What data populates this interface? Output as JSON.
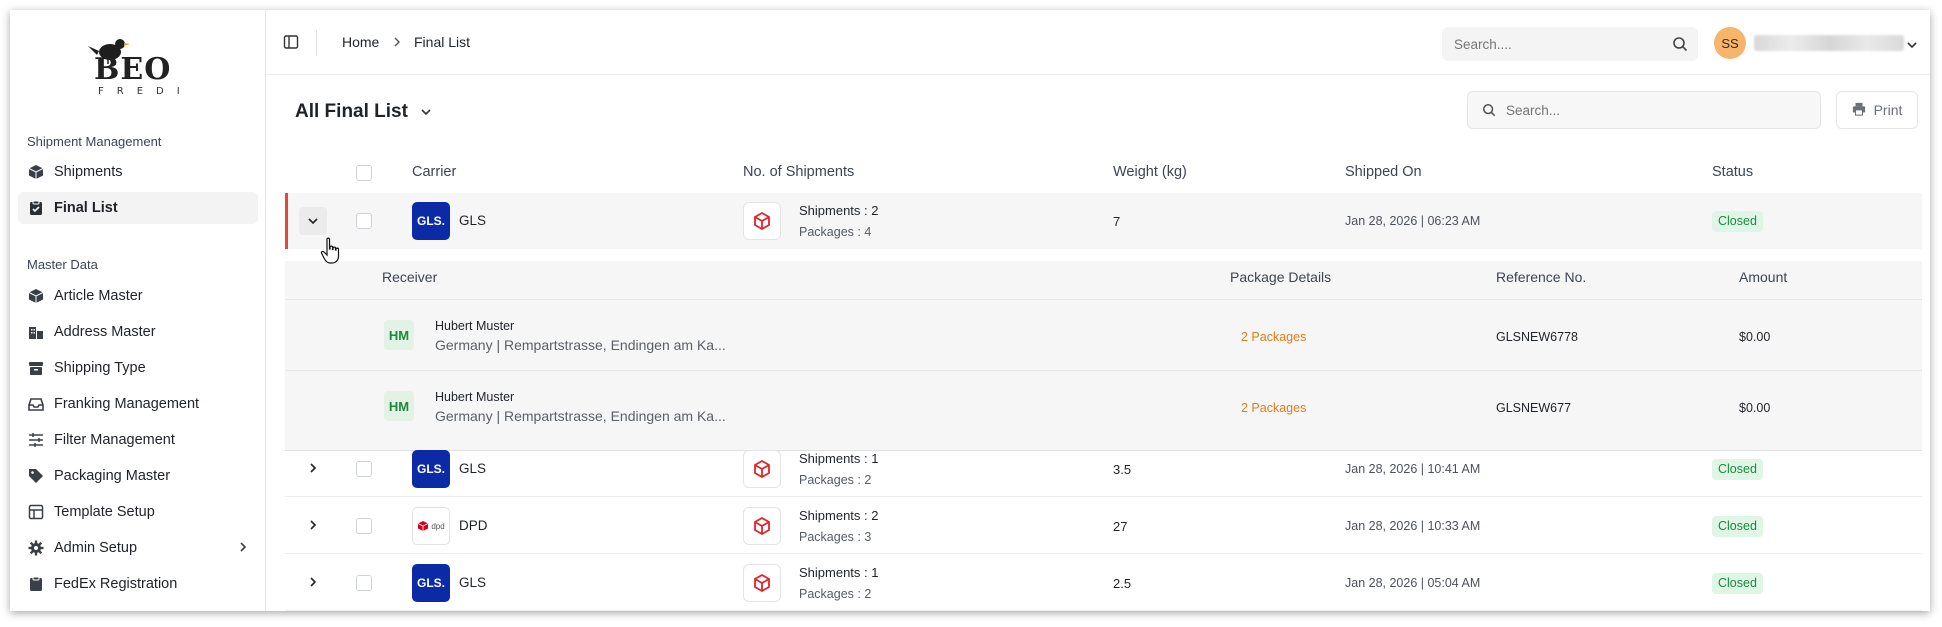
{
  "app": {
    "logo_text": "BEO",
    "logo_subtext": "FREDI"
  },
  "sidebar": {
    "sections": [
      {
        "title": "Shipment Management",
        "items": [
          {
            "label": "Shipments",
            "icon": "box-icon"
          },
          {
            "label": "Final List",
            "icon": "clipboard-check-icon",
            "active": true
          }
        ]
      },
      {
        "title": "Master Data",
        "items": [
          {
            "label": "Article Master",
            "icon": "box-icon"
          },
          {
            "label": "Address Master",
            "icon": "building-icon"
          },
          {
            "label": "Shipping Type",
            "icon": "archive-icon"
          },
          {
            "label": "Franking Management",
            "icon": "inbox-icon"
          },
          {
            "label": "Filter Management",
            "icon": "sliders-icon"
          },
          {
            "label": "Packaging Master",
            "icon": "tag-icon"
          },
          {
            "label": "Template Setup",
            "icon": "template-icon"
          },
          {
            "label": "Admin Setup",
            "icon": "gear-icon",
            "has_submenu": true
          },
          {
            "label": "FedEx Registration",
            "icon": "clipboard-icon"
          }
        ]
      }
    ]
  },
  "header": {
    "breadcrumb": [
      "Home",
      "Final List"
    ],
    "search_placeholder": "Search....",
    "user_initials": "SS"
  },
  "main": {
    "title": "All Final List",
    "search_placeholder": "Search...",
    "print_label": "Print",
    "columns": [
      "Carrier",
      "No. of Shipments",
      "Weight (kg)",
      "Shipped On",
      "Status"
    ],
    "rows": [
      {
        "carrier": "GLS",
        "carrier_logo": "GLS.",
        "shipments": "Shipments : 2",
        "packages": "Packages : 4",
        "weight": "7",
        "shipped_on": "Jan 28, 2026 | 06:23 AM",
        "status": "Closed",
        "expanded": true
      },
      {
        "carrier": "GLS",
        "carrier_logo": "GLS.",
        "shipments": "Shipments : 1",
        "packages": "Packages : 2",
        "weight": "3.5",
        "shipped_on": "Jan 28, 2026 | 10:41 AM",
        "status": "Closed"
      },
      {
        "carrier": "DPD",
        "carrier_logo": "dpd",
        "shipments": "Shipments : 2",
        "packages": "Packages : 3",
        "weight": "27",
        "shipped_on": "Jan 28, 2026 | 10:33 AM",
        "status": "Closed"
      },
      {
        "carrier": "GLS",
        "carrier_logo": "GLS.",
        "shipments": "Shipments : 1",
        "packages": "Packages : 2",
        "weight": "2.5",
        "shipped_on": "Jan 28, 2026 | 05:04 AM",
        "status": "Closed"
      }
    ],
    "detail": {
      "columns": [
        "Receiver",
        "Package Details",
        "Reference No.",
        "Amount"
      ],
      "rows": [
        {
          "initials": "HM",
          "name": "Hubert Muster",
          "address": "Germany | Rempartstrasse, Endingen am Ka...",
          "package_details": "2 Packages",
          "reference": "GLSNEW6778",
          "amount": "$0.00"
        },
        {
          "initials": "HM",
          "name": "Hubert Muster",
          "address": "Germany | Rempartstrasse, Endingen am Ka...",
          "package_details": "2 Packages",
          "reference": "GLSNEW677",
          "amount": "$0.00"
        }
      ]
    }
  },
  "colors": {
    "accent_red": "#e5483a",
    "status_green": "#1b8a3c",
    "status_bg": "#dff6e6",
    "gls_blue": "#0a2aa6",
    "package_orange": "#e07b1e",
    "avatar_orange": "#f7b46b"
  }
}
